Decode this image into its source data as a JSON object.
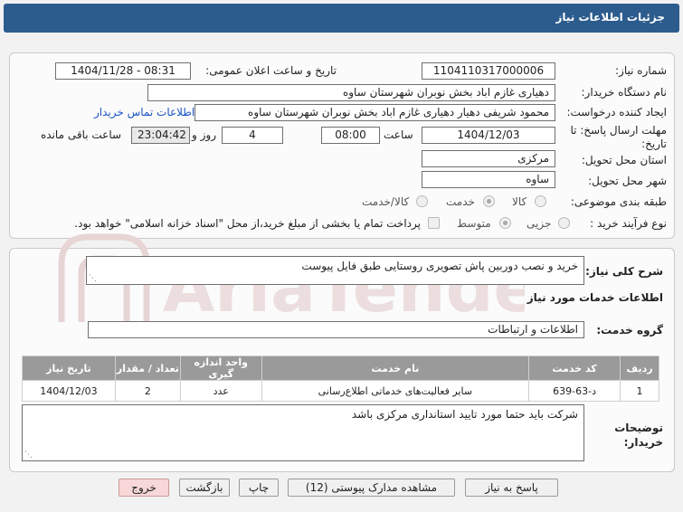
{
  "header": {
    "title": "جزئیات اطلاعات نیاز"
  },
  "fields": {
    "need_number_label": "شماره نیاز:",
    "need_number": "1104110317000006",
    "announce_label": "تاریخ و ساعت اعلان عمومی:",
    "announce_value": "1404/11/28 - 08:31",
    "buyer_org_label": "نام دستگاه خریدار:",
    "buyer_org": "دهیاری غازم اباد بخش نوبران شهرستان ساوه",
    "creator_label": "ایجاد کننده درخواست:",
    "creator": "محمود شریفی دهیار دهیاری غازم اباد بخش نوبران شهرستان ساوه",
    "contact_link": "اطلاعات تماس خریدار",
    "deadline_label": "مهلت ارسال پاسخ: تا تاریخ:",
    "deadline_date": "1404/12/03",
    "time_label": "ساعت",
    "deadline_time": "08:00",
    "days_value": "4",
    "day_label": "روز و",
    "remaining_time": "23:04:42",
    "remaining_label": "ساعت باقی مانده",
    "province_label": "استان محل تحویل:",
    "province": "مرکزی",
    "city_label": "شهر محل تحویل:",
    "city": "ساوه",
    "category_label": "طبقه بندی موضوعی:",
    "category_options": [
      "کالا",
      "خدمت",
      "کالا/خدمت"
    ],
    "purchase_label": "نوع فرآیند خرید :",
    "purchase_options": [
      "جزیی",
      "متوسط"
    ],
    "payment_note": "پرداخت تمام یا بخشی از مبلغ خرید،از محل \"اسناد خزانه اسلامی\" خواهد بود."
  },
  "main": {
    "summary_label": "شرح کلی نیاز:",
    "summary": "خرید و نصب دوربین پاش تصویری روستایی طبق فایل پیوست",
    "services_title": "اطلاعات خدمات مورد نیاز",
    "service_group_label": "گروه خدمت:",
    "service_group": "اطلاعات و ارتباطات",
    "table_headers": [
      "ردیف",
      "کد خدمت",
      "نام خدمت",
      "واحد اندازه گیری",
      "تعداد / مقدار",
      "تاریخ نیاز"
    ],
    "table_rows": [
      [
        "1",
        "د-63-639",
        "سایر فعالیت‌های خدماتی اطلاع‌رسانی",
        "عدد",
        "2",
        "1404/12/03"
      ]
    ],
    "buyer_notes_label": "توضیحات خریدار:",
    "buyer_notes": "شرکت باید حتما مورد تایید استانداری مرکزی باشد"
  },
  "buttons": {
    "respond": "پاسخ به نیاز",
    "attachments": "مشاهده مدارک پیوستی (12)",
    "print": "چاپ",
    "back": "بازگشت",
    "exit": "خروج"
  },
  "watermark": {
    "text": "AriaTender.net"
  },
  "colors": {
    "title_bar": "#2c5c8e",
    "link": "#1b55c4",
    "table_header": "#9a9a9a",
    "exit_button": "#f7d7d7"
  }
}
